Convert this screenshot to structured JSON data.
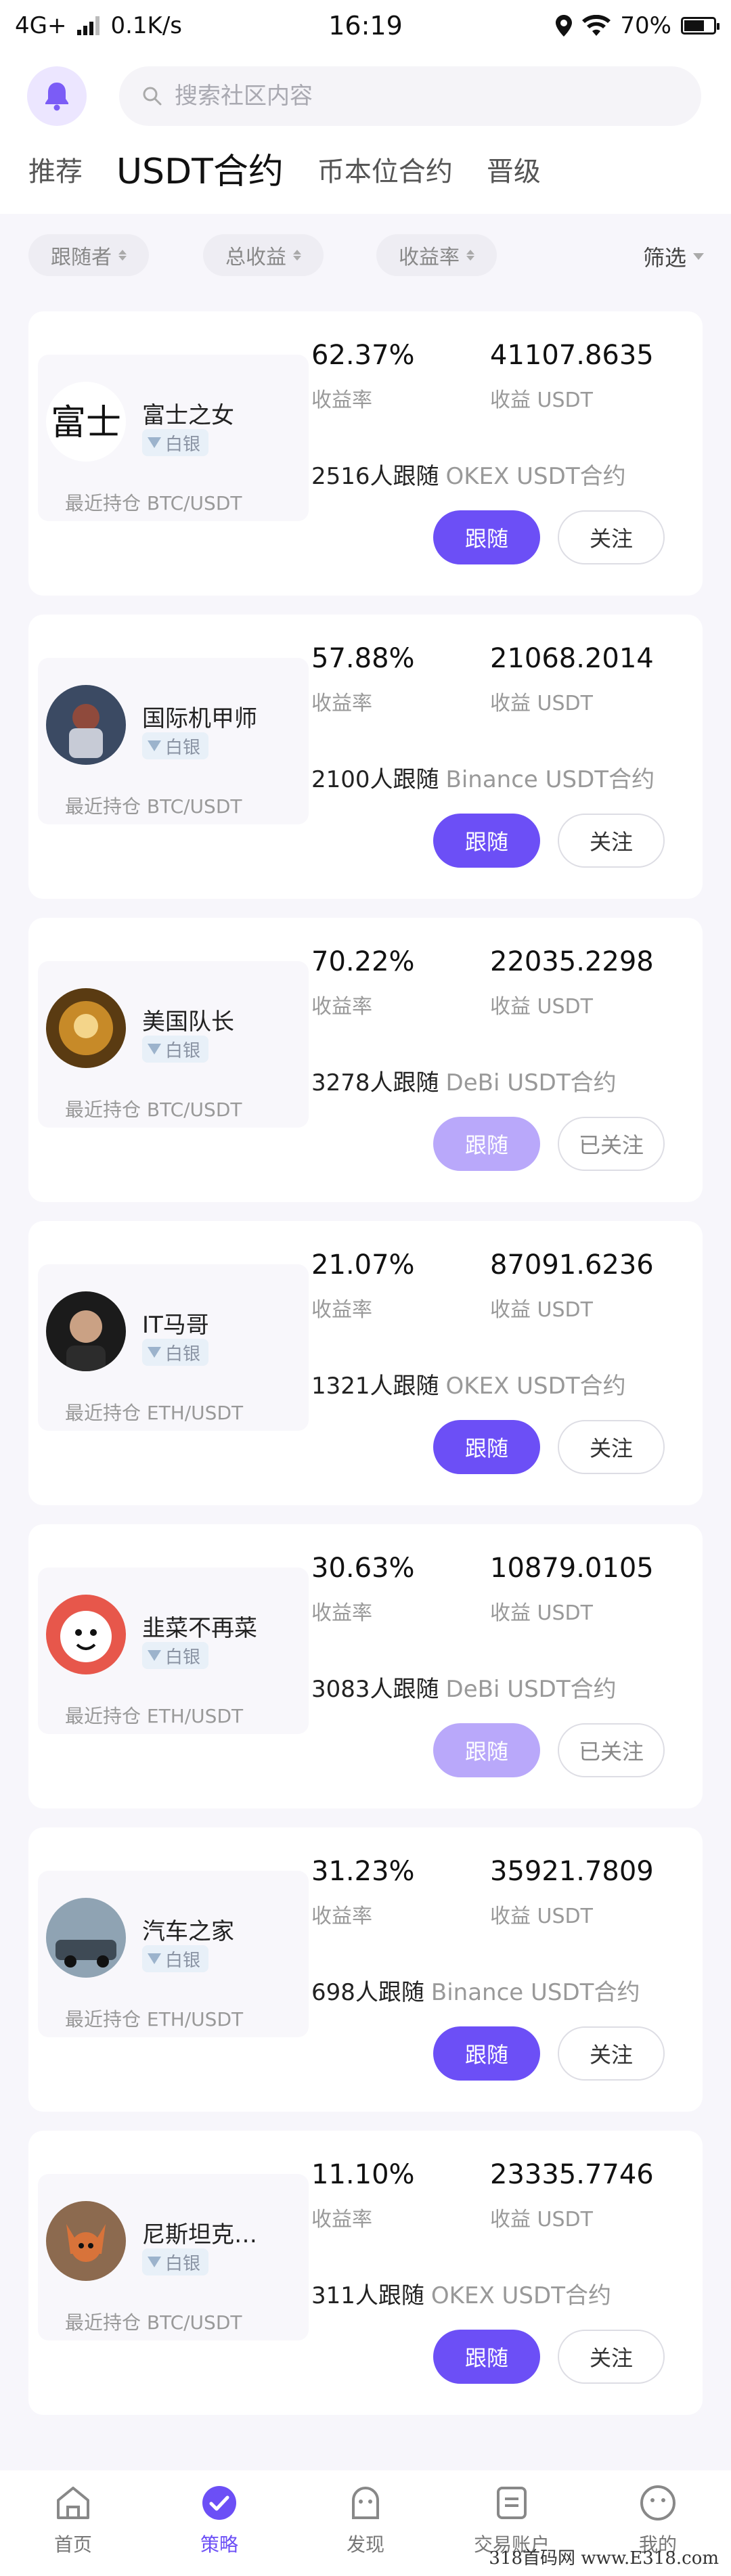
{
  "status_bar": {
    "network": "4G+",
    "speed": "0.1K/s",
    "time": "16:19",
    "battery": "70%",
    "battery_level": 0.7
  },
  "header": {
    "search_placeholder": "搜索社区内容",
    "tabs": [
      {
        "label": "推荐",
        "active": false
      },
      {
        "label": "USDT合约",
        "active": true
      },
      {
        "label": "币本位合约",
        "active": false
      },
      {
        "label": "晋级",
        "active": false
      }
    ]
  },
  "filters": {
    "followers": "跟随者",
    "total_profit": "总收益",
    "yield": "收益率",
    "filter": "筛选"
  },
  "labels": {
    "yield_rate": "收益率",
    "profit_usdt": "收益 USDT"
  },
  "traders": [
    {
      "name": "富士之女",
      "level": "白银",
      "holding": "最近持仓 BTC/USDT",
      "yield": "62.37%",
      "profit": "41107.8635",
      "followers": "2516人跟随",
      "exchange": "OKEX USDT合约",
      "follow_label": "跟随",
      "watch_label": "关注",
      "followed": false,
      "watched": false
    },
    {
      "name": "国际机甲师",
      "level": "白银",
      "holding": "最近持仓 BTC/USDT",
      "yield": "57.88%",
      "profit": "21068.2014",
      "followers": "2100人跟随",
      "exchange": "Binance USDT合约",
      "follow_label": "跟随",
      "watch_label": "关注",
      "followed": false,
      "watched": false
    },
    {
      "name": "美国队长",
      "level": "白银",
      "holding": "最近持仓 BTC/USDT",
      "yield": "70.22%",
      "profit": "22035.2298",
      "followers": "3278人跟随",
      "exchange": "DeBi USDT合约",
      "follow_label": "跟随",
      "watch_label": "已关注",
      "followed": true,
      "watched": true
    },
    {
      "name": "IT马哥",
      "level": "白银",
      "holding": "最近持仓 ETH/USDT",
      "yield": "21.07%",
      "profit": "87091.6236",
      "followers": "1321人跟随",
      "exchange": "OKEX USDT合约",
      "follow_label": "跟随",
      "watch_label": "关注",
      "followed": false,
      "watched": false
    },
    {
      "name": "韭菜不再菜",
      "level": "白银",
      "holding": "最近持仓 ETH/USDT",
      "yield": "30.63%",
      "profit": "10879.0105",
      "followers": "3083人跟随",
      "exchange": "DeBi USDT合约",
      "follow_label": "跟随",
      "watch_label": "已关注",
      "followed": true,
      "watched": true
    },
    {
      "name": "汽车之家",
      "level": "白银",
      "holding": "最近持仓 ETH/USDT",
      "yield": "31.23%",
      "profit": "35921.7809",
      "followers": "698人跟随",
      "exchange": "Binance USDT合约",
      "follow_label": "跟随",
      "watch_label": "关注",
      "followed": false,
      "watched": false
    },
    {
      "name": "尼斯坦克…",
      "level": "白银",
      "holding": "最近持仓 BTC/USDT",
      "yield": "11.10%",
      "profit": "23335.7746",
      "followers": "311人跟随",
      "exchange": "OKEX USDT合约",
      "follow_label": "跟随",
      "watch_label": "关注",
      "followed": false,
      "watched": false
    }
  ],
  "bottom_nav": [
    {
      "label": "首页",
      "icon": "home-icon",
      "active": false
    },
    {
      "label": "策略",
      "icon": "strategy-icon",
      "active": true
    },
    {
      "label": "发现",
      "icon": "discover-icon",
      "active": false
    },
    {
      "label": "交易账户",
      "icon": "account-icon",
      "active": false
    },
    {
      "label": "我的",
      "icon": "profile-icon",
      "active": false
    }
  ],
  "colors": {
    "accent": "#6c4ff6",
    "accent_disabled": "#b9a8fa",
    "badge_bg": "#e8f0f8"
  },
  "watermark": "318首码网 www.E318.com"
}
